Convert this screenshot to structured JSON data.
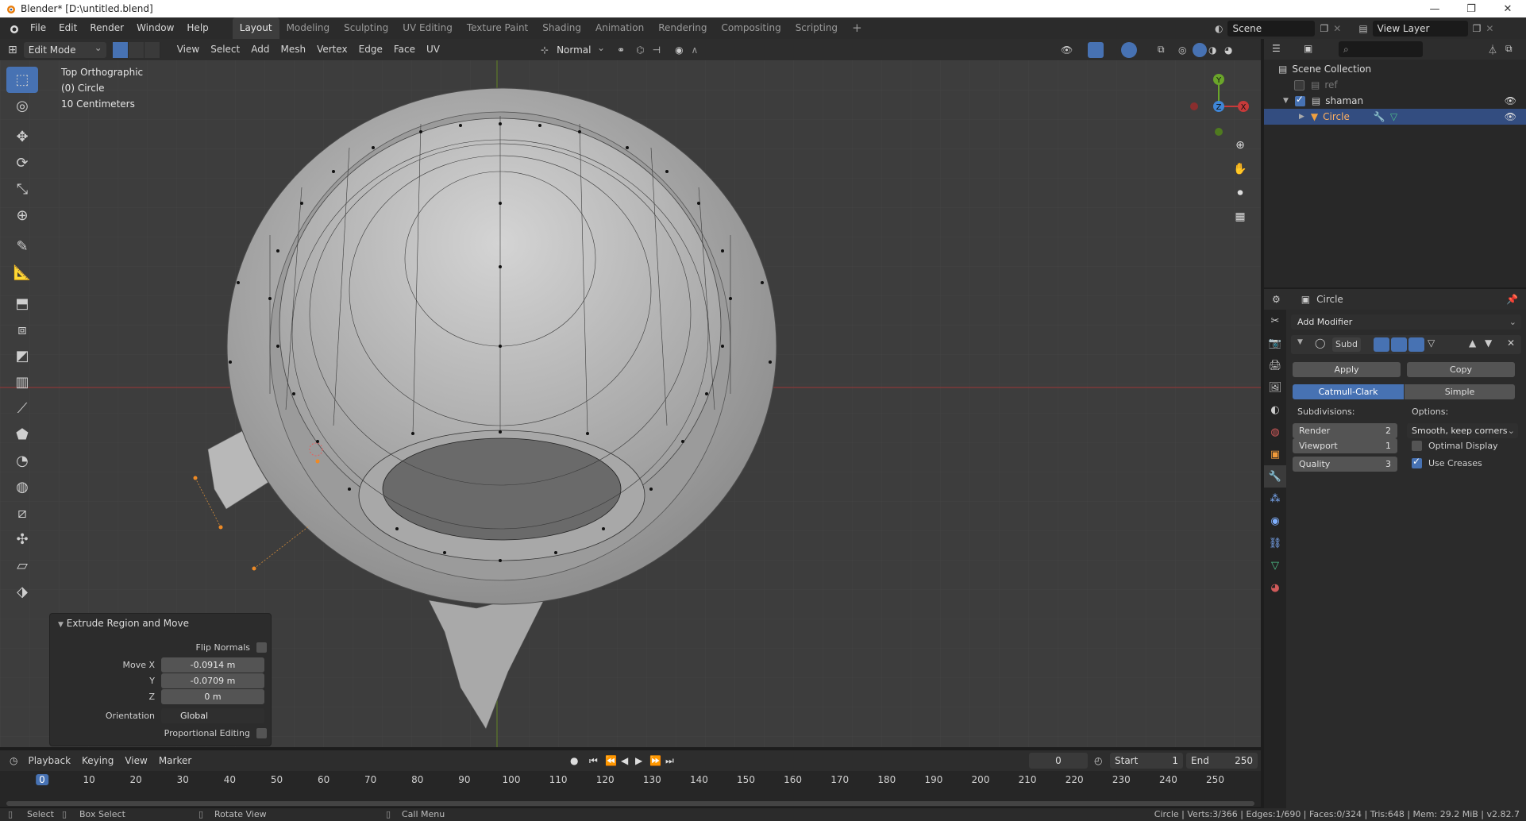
{
  "window": {
    "title": "Blender* [D:\\untitled.blend]",
    "controls": [
      "—",
      "❐",
      "✕"
    ]
  },
  "menubar": {
    "items": [
      "File",
      "Edit",
      "Render",
      "Window",
      "Help"
    ],
    "workspaces": [
      "Layout",
      "Modeling",
      "Sculpting",
      "UV Editing",
      "Texture Paint",
      "Shading",
      "Animation",
      "Rendering",
      "Compositing",
      "Scripting"
    ],
    "active_workspace": "Layout",
    "add_workspace": "+",
    "scene": "Scene",
    "view_layer": "View Layer"
  },
  "viewport_header": {
    "mode": "Edit Mode",
    "menus": [
      "View",
      "Select",
      "Add",
      "Mesh",
      "Vertex",
      "Edge",
      "Face",
      "UV"
    ],
    "orientation": "Normal"
  },
  "viewport": {
    "view_name": "Top Orthographic",
    "object_info": "(0) Circle",
    "scale_info": "10 Centimeters",
    "gizmo_axes": {
      "y": "Y",
      "z": "Z",
      "x": "X"
    },
    "colors": {
      "x_axis": "#c63a3a",
      "y_axis": "#6aa52a",
      "z_axis": "#3f86d6",
      "bg": "#3d3d3d",
      "selected_vertex": "#f08a24"
    }
  },
  "operator_panel": {
    "title": "Extrude Region and Move",
    "flip_normals_label": "Flip Normals",
    "flip_normals": false,
    "move_x_label": "Move X",
    "move_x": "-0.0914 m",
    "y_label": "Y",
    "y": "-0.0709 m",
    "z_label": "Z",
    "z": "0 m",
    "orientation_label": "Orientation",
    "orientation": "Global",
    "proportional_label": "Proportional Editing",
    "proportional": false
  },
  "timeline": {
    "menus": [
      "Playback",
      "Keying",
      "View",
      "Marker"
    ],
    "current_frame": "0",
    "start_label": "Start",
    "start": "1",
    "end_label": "End",
    "end": "250",
    "ticks": [
      "0",
      "10",
      "20",
      "30",
      "40",
      "50",
      "60",
      "70",
      "80",
      "90",
      "100",
      "110",
      "120",
      "130",
      "140",
      "150",
      "160",
      "170",
      "180",
      "190",
      "200",
      "210",
      "220",
      "230",
      "240",
      "250"
    ]
  },
  "statusbar": {
    "select": "Select",
    "box_select": "Box Select",
    "rotate_view": "Rotate View",
    "call_menu": "Call Menu",
    "stats": "Circle | Verts:3/366 | Edges:1/690 | Faces:0/324 | Tris:648 | Mem: 29.2 MiB | v2.82.7"
  },
  "outliner": {
    "root": "Scene Collection",
    "items": [
      {
        "name": "ref",
        "visible": false
      },
      {
        "name": "shaman",
        "visible": true
      },
      {
        "name": "Circle",
        "visible": true,
        "selected": true
      }
    ]
  },
  "properties": {
    "object_name": "Circle",
    "add_modifier": "Add Modifier",
    "modifier_name": "Subd",
    "apply_label": "Apply",
    "copy_label": "Copy",
    "catmull_label": "Catmull-Clark",
    "simple_label": "Simple",
    "subdivisions_label": "Subdivisions:",
    "options_label": "Options:",
    "render_label": "Render",
    "render_value": "2",
    "viewport_label": "Viewport",
    "viewport_value": "1",
    "quality_label": "Quality",
    "quality_value": "3",
    "uv_smooth": "Smooth, keep corners",
    "optimal_display_label": "Optimal Display",
    "optimal_display": false,
    "use_creases_label": "Use Creases",
    "use_creases": true
  }
}
